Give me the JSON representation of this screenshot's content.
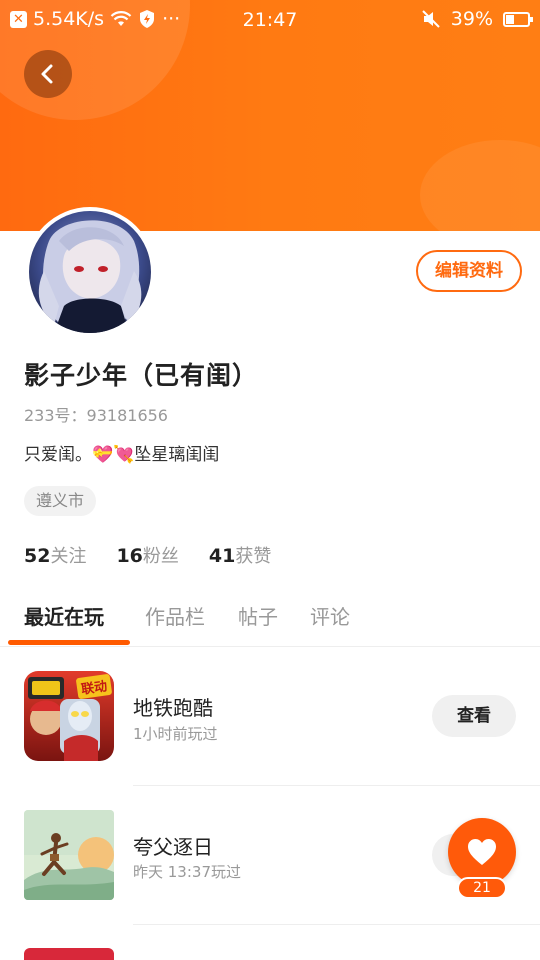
{
  "status_bar": {
    "speed": "5.54K/s",
    "time": "21:47",
    "battery": "39%",
    "battery_level": 0.39,
    "more": "···"
  },
  "profile": {
    "name": "影子少年（已有闺）",
    "uid": "233号：93181656",
    "bio": "只爱闺。💝💘坠星璃闺闺",
    "location": "遵义市",
    "edit_label": "编辑资料"
  },
  "stats": [
    {
      "count": "52",
      "label": "关注"
    },
    {
      "count": "16",
      "label": "粉丝"
    },
    {
      "count": "41",
      "label": "获赞"
    }
  ],
  "tabs": [
    {
      "label": "最近在玩",
      "active": true
    },
    {
      "label": "作品栏",
      "active": false
    },
    {
      "label": "帖子",
      "active": false
    },
    {
      "label": "评论",
      "active": false
    }
  ],
  "games": [
    {
      "title": "地铁跑酷",
      "subtitle": "1小时前玩过",
      "action": "查看",
      "badge": "联动",
      "icon": "subway-surfers-icon"
    },
    {
      "title": "夸父逐日",
      "subtitle": "昨天 13:37玩过",
      "action": "查看",
      "icon": "kuafu-icon"
    }
  ],
  "fab": {
    "count": "21",
    "icon": "heart-icon"
  },
  "colors": {
    "accent": "#ff6a10",
    "header_start": "#ff6a10",
    "header_end": "#ff7e14"
  }
}
